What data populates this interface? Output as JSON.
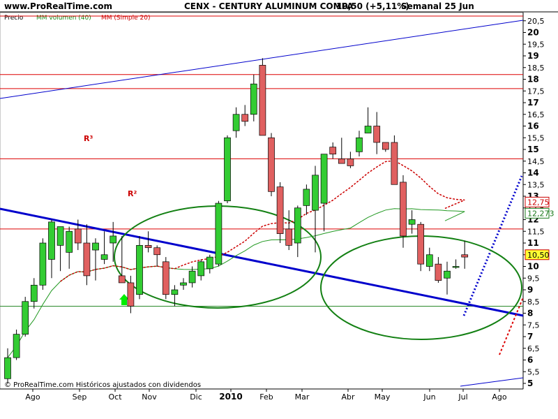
{
  "header": {
    "site": "www.ProRealTime.com",
    "title": "CENX - CENTURY ALUMINUM COMPA",
    "price": "10,50 (+5,11%)",
    "period": "Semanal  25 Jun"
  },
  "legend": {
    "precio": "Precio",
    "mm_volumen": "MM volumen (40)",
    "mm_simple": "MM (Simple 20)"
  },
  "footer": {
    "copyright": "© ProRealTime.com Históricos ajustados con dividendos"
  },
  "annotations": {
    "r1": "R³",
    "r2": "R²"
  },
  "colors": {
    "up": "#33cc33",
    "down": "#e06060",
    "resistance": "#dd0000",
    "trend": "#0000cc",
    "ellipse": "#138013",
    "ma20": "#cc0000",
    "ma40": "#229922",
    "arrow": "#00ee00"
  },
  "chart_data": {
    "type": "candlestick",
    "title": "CENX - CENTURY ALUMINUM COMPA",
    "ylim": [
      5,
      20.6
    ],
    "y_ticks": [
      "20,5",
      "20",
      "19,5",
      "19",
      "18,5",
      "18",
      "17,5",
      "17",
      "16,5",
      "16",
      "15,5",
      "15",
      "14,5",
      "14",
      "13,5",
      "13",
      "12,5",
      "12",
      "11,5",
      "11",
      "10,5",
      "10",
      "9,5",
      "9",
      "8,5",
      "8",
      "7,5",
      "7",
      "6,5",
      "6",
      "5,5",
      "5"
    ],
    "x_labels": [
      "Ago",
      "Sep",
      "Oct",
      "Nov",
      "Dic",
      "2010",
      "Feb",
      "Mar",
      "Abr",
      "May",
      "Jun",
      "Jul",
      "Ago"
    ],
    "candles": [
      {
        "o": 5.2,
        "h": 6.5,
        "l": 5.0,
        "c": 6.1
      },
      {
        "o": 6.1,
        "h": 7.3,
        "l": 6.0,
        "c": 7.1
      },
      {
        "o": 7.1,
        "h": 8.7,
        "l": 7.0,
        "c": 8.5
      },
      {
        "o": 8.5,
        "h": 9.5,
        "l": 8.2,
        "c": 9.2
      },
      {
        "o": 9.2,
        "h": 11.2,
        "l": 9.0,
        "c": 11.0
      },
      {
        "o": 10.3,
        "h": 12.0,
        "l": 9.5,
        "c": 11.9
      },
      {
        "o": 10.9,
        "h": 11.7,
        "l": 9.8,
        "c": 11.7
      },
      {
        "o": 10.6,
        "h": 11.7,
        "l": 9.9,
        "c": 11.5
      },
      {
        "o": 11.6,
        "h": 12.0,
        "l": 10.7,
        "c": 11.0
      },
      {
        "o": 11.0,
        "h": 11.8,
        "l": 9.2,
        "c": 9.6
      },
      {
        "o": 10.7,
        "h": 11.2,
        "l": 9.4,
        "c": 11.0
      },
      {
        "o": 10.3,
        "h": 11.5,
        "l": 10.1,
        "c": 10.5
      },
      {
        "o": 11.0,
        "h": 11.9,
        "l": 10.2,
        "c": 11.3
      },
      {
        "o": 9.6,
        "h": 11.3,
        "l": 9.5,
        "c": 9.3
      },
      {
        "o": 9.3,
        "h": 9.6,
        "l": 8.0,
        "c": 8.3
      },
      {
        "o": 8.8,
        "h": 11.3,
        "l": 8.6,
        "c": 10.9
      },
      {
        "o": 10.9,
        "h": 11.5,
        "l": 10.6,
        "c": 10.8
      },
      {
        "o": 10.8,
        "h": 10.9,
        "l": 10.0,
        "c": 10.5
      },
      {
        "o": 10.2,
        "h": 10.4,
        "l": 8.6,
        "c": 8.8
      },
      {
        "o": 8.8,
        "h": 9.2,
        "l": 8.3,
        "c": 9.0
      },
      {
        "o": 9.2,
        "h": 9.5,
        "l": 9.0,
        "c": 9.3
      },
      {
        "o": 9.3,
        "h": 10.0,
        "l": 9.1,
        "c": 9.8
      },
      {
        "o": 9.6,
        "h": 10.3,
        "l": 9.4,
        "c": 10.2
      },
      {
        "o": 9.9,
        "h": 10.5,
        "l": 9.7,
        "c": 10.4
      },
      {
        "o": 10.1,
        "h": 12.8,
        "l": 10.0,
        "c": 12.7
      },
      {
        "o": 12.8,
        "h": 15.6,
        "l": 12.7,
        "c": 15.5
      },
      {
        "o": 15.8,
        "h": 16.8,
        "l": 15.5,
        "c": 16.5
      },
      {
        "o": 16.5,
        "h": 16.9,
        "l": 16.0,
        "c": 16.2
      },
      {
        "o": 16.5,
        "h": 18.2,
        "l": 16.2,
        "c": 17.8
      },
      {
        "o": 18.6,
        "h": 18.9,
        "l": 15.8,
        "c": 15.6
      },
      {
        "o": 15.5,
        "h": 15.7,
        "l": 13.0,
        "c": 13.2
      },
      {
        "o": 13.4,
        "h": 13.6,
        "l": 11.0,
        "c": 11.4
      },
      {
        "o": 11.6,
        "h": 12.4,
        "l": 10.7,
        "c": 10.9
      },
      {
        "o": 11.0,
        "h": 12.6,
        "l": 10.4,
        "c": 12.5
      },
      {
        "o": 12.6,
        "h": 13.5,
        "l": 12.2,
        "c": 13.3
      },
      {
        "o": 12.4,
        "h": 14.3,
        "l": 10.6,
        "c": 13.9
      },
      {
        "o": 12.7,
        "h": 14.8,
        "l": 11.5,
        "c": 14.8
      },
      {
        "o": 15.1,
        "h": 15.3,
        "l": 14.6,
        "c": 14.8
      },
      {
        "o": 14.6,
        "h": 15.5,
        "l": 14.4,
        "c": 14.4
      },
      {
        "o": 14.6,
        "h": 14.9,
        "l": 14.2,
        "c": 14.3
      },
      {
        "o": 14.9,
        "h": 15.8,
        "l": 14.7,
        "c": 15.5
      },
      {
        "o": 15.7,
        "h": 16.8,
        "l": 15.7,
        "c": 16.0
      },
      {
        "o": 16.0,
        "h": 16.6,
        "l": 14.8,
        "c": 15.3
      },
      {
        "o": 15.3,
        "h": 15.3,
        "l": 14.9,
        "c": 15.0
      },
      {
        "o": 15.3,
        "h": 15.6,
        "l": 13.5,
        "c": 13.5
      },
      {
        "o": 13.6,
        "h": 13.9,
        "l": 10.8,
        "c": 11.3
      },
      {
        "o": 11.8,
        "h": 12.4,
        "l": 11.4,
        "c": 12.0
      },
      {
        "o": 11.8,
        "h": 11.9,
        "l": 9.8,
        "c": 10.1
      },
      {
        "o": 10.0,
        "h": 10.8,
        "l": 9.8,
        "c": 10.5
      },
      {
        "o": 10.1,
        "h": 10.4,
        "l": 9.3,
        "c": 9.4
      },
      {
        "o": 9.5,
        "h": 10.2,
        "l": 8.8,
        "c": 9.8
      },
      {
        "o": 10.0,
        "h": 10.3,
        "l": 9.9,
        "c": 10.0
      },
      {
        "o": 10.5,
        "h": 11.1,
        "l": 9.9,
        "c": 10.4
      }
    ],
    "horizontal_lines": [
      20.7,
      18.2,
      17.6,
      14.6,
      11.6,
      8.3
    ],
    "last_values": {
      "price": "10,50",
      "ma40": "12,273",
      "ma20": "12,75"
    }
  }
}
